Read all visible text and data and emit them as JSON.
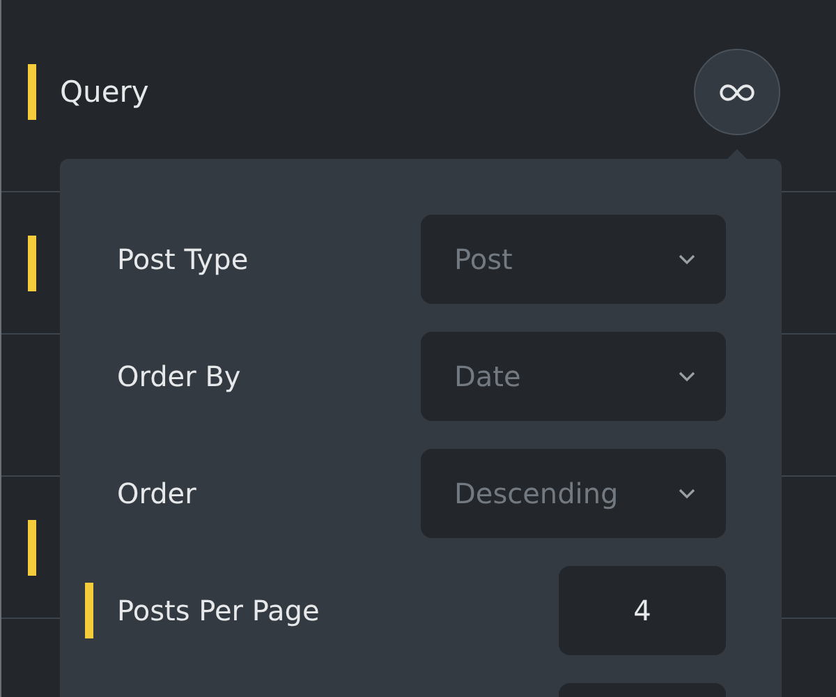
{
  "background_rows": [
    {
      "label": "Query",
      "marker": true
    },
    {
      "marker": true
    },
    {
      "marker": false
    },
    {
      "marker": true
    },
    {
      "marker": false
    }
  ],
  "popover": {
    "fields": [
      {
        "kind": "select",
        "label": "Post Type",
        "value": "Post",
        "modified": false
      },
      {
        "kind": "select",
        "label": "Order By",
        "value": "Date",
        "modified": false
      },
      {
        "kind": "select",
        "label": "Order",
        "value": "Descending",
        "modified": false
      },
      {
        "kind": "number",
        "label": "Posts Per Page",
        "value": "4",
        "modified": true
      },
      {
        "kind": "number",
        "modified": false
      }
    ]
  }
}
